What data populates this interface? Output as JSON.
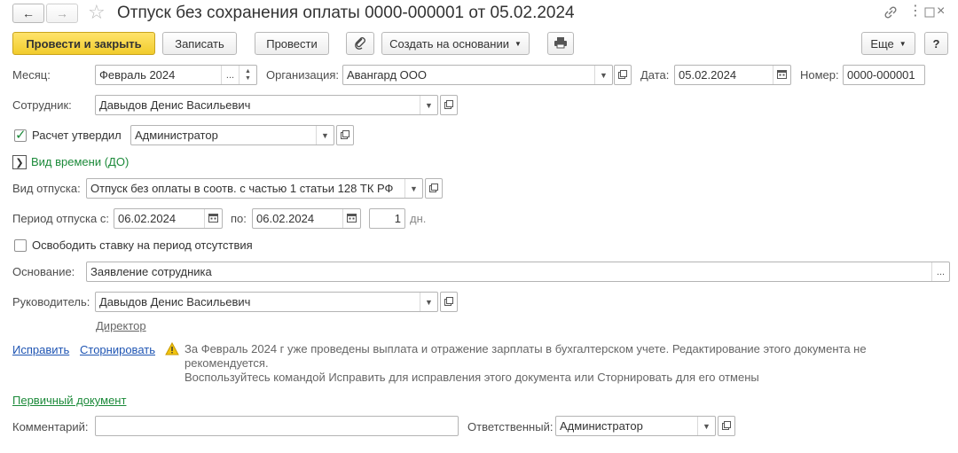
{
  "window": {
    "title": "Отпуск без сохранения оплаты 0000-000001 от 05.02.2024"
  },
  "toolbar": {
    "post_close_label": "Провести и закрыть",
    "save_label": "Записать",
    "post_label": "Провести",
    "create_based_label": "Создать на основании",
    "more_label": "Еще",
    "help_label": "?"
  },
  "form": {
    "month": {
      "label": "Месяц:",
      "value": "Февраль 2024",
      "dots": "..."
    },
    "organization": {
      "label": "Организация:",
      "value": "Авангард ООО"
    },
    "date": {
      "label": "Дата:",
      "value": "05.02.2024"
    },
    "number": {
      "label": "Номер:",
      "value": "0000-000001"
    },
    "employee": {
      "label": "Сотрудник:",
      "value": "Давыдов Денис Васильевич"
    },
    "calc_approved": {
      "label": "Расчет утвердил",
      "checked": true,
      "value": "Администратор"
    },
    "time_kind": {
      "label": "Вид времени (ДО)"
    },
    "leave_kind": {
      "label": "Вид отпуска:",
      "value": "Отпуск без оплаты в соотв. с частью 1 статьи 128 ТК РФ"
    },
    "period": {
      "label_from": "Период отпуска с:",
      "from": "06.02.2024",
      "label_to": "по:",
      "to": "06.02.2024",
      "days": "1",
      "days_unit": "дн."
    },
    "release_rate": {
      "label": "Освободить ставку на период отсутствия",
      "checked": false
    },
    "basis": {
      "label": "Основание:",
      "value": "Заявление сотрудника",
      "dots": "..."
    },
    "manager": {
      "label": "Руководитель:",
      "value": "Давыдов Денис Васильевич",
      "position": "Директор"
    },
    "actions": {
      "fix": "Исправить",
      "reverse": "Сторнировать"
    },
    "warning": {
      "line1": "За Февраль 2024 г уже проведены выплата и отражение зарплаты в бухгалтерском учете. Редактирование этого документа не",
      "line2": "рекомендуется.",
      "line3": "Воспользуйтесь командой Исправить для исправления этого документа или Сторнировать для его отмены"
    },
    "primary_doc": "Первичный документ",
    "comment": {
      "label": "Комментарий:",
      "value": ""
    },
    "responsible": {
      "label": "Ответственный:",
      "value": "Администратор"
    }
  },
  "colors": {
    "primary_button": "#f5d33a",
    "link": "#1f55b3",
    "green_link": "#1c8a3a",
    "warning_icon": "#e8b400"
  }
}
